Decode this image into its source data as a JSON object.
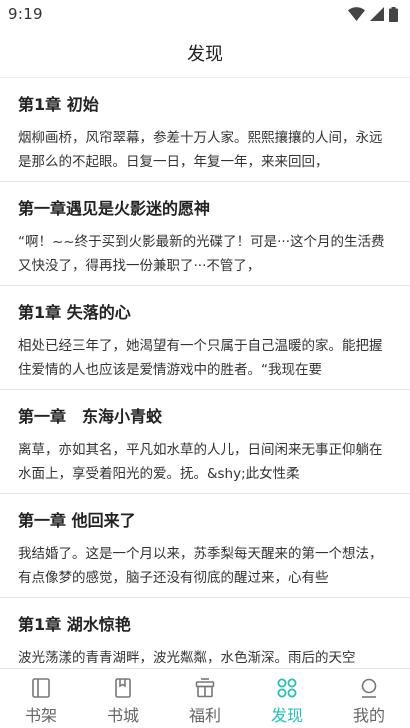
{
  "status_bar": {
    "time": "9:19"
  },
  "header": {
    "title": "发现"
  },
  "articles": [
    {
      "title": "第1章 初始",
      "excerpt": "烟柳画桥，风帘翠幕，参差十万人家。熙熙攘攘的人间，永远是那么的不起眼。日复一日，年复一年，来来回回，"
    },
    {
      "title": "第一章遇见是火影迷的愿神",
      "excerpt": "“啊！~~终于买到火影最新的光碟了！可是···这个月的生活费又快没了，得再找一份兼职了···不管了，"
    },
    {
      "title": "第1章 失落的心",
      "excerpt": "相处已经三年了，她渴望有一个只属于自己温暖的家。能把握住爱情的人也应该是爱情游戏中的胜者。“我现在要"
    },
    {
      "title": "第一章　东海小青蛟",
      "excerpt": "离草，亦如其名，平凡如水草的人儿，日间闲来无事正仰躺在水面上，享受着阳光的爱。抚。&shy;此女性柔"
    },
    {
      "title": "第一章 他回来了",
      "excerpt": "我结婚了。这是一个月以来，苏季梨每天醒来的第一个想法，有点像梦的感觉，脑子还没有彻底的醒过来，心有些"
    },
    {
      "title": "第1章 湖水惊艳",
      "excerpt": "波光荡漾的青青湖畔，波光粼粼，水色渐深。雨后的天空"
    }
  ],
  "tabbar": {
    "active_color": "#24c2b5",
    "inactive_color": "#666666",
    "tabs": [
      {
        "label": "书架",
        "icon": "bookshelf-icon"
      },
      {
        "label": "书城",
        "icon": "book-icon"
      },
      {
        "label": "福利",
        "icon": "gift-icon"
      },
      {
        "label": "发现",
        "icon": "discover-icon",
        "active": true
      },
      {
        "label": "我的",
        "icon": "profile-icon"
      }
    ]
  }
}
